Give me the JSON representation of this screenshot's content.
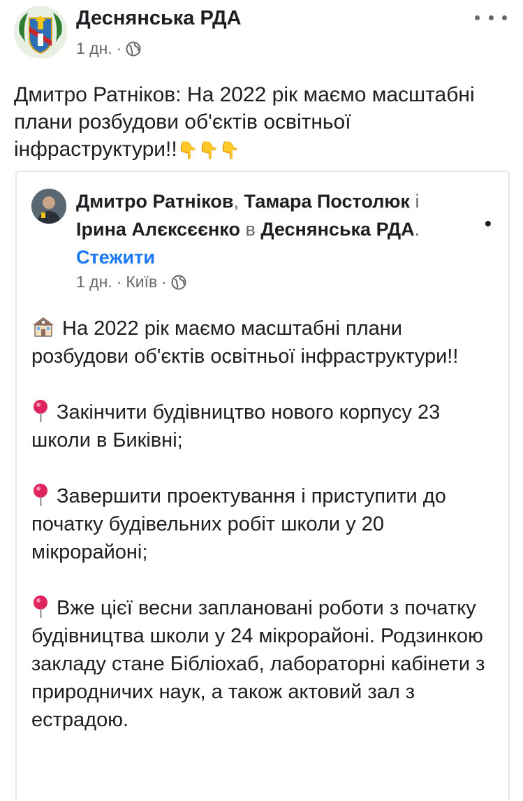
{
  "post": {
    "page_name": "Деснянська РДА",
    "time": "1 дн.",
    "meta_dot": "·",
    "text_main": "Дмитро Ратніков: На 2022 рік маємо масштабні плани розбудови об'єктів освітньої інфраструктури!!",
    "hand_emojis": [
      "👇",
      "👇",
      "👇"
    ],
    "audience_icon": "globe-icon"
  },
  "shared": {
    "author1": "Дмитро Ратніков",
    "comma": ",",
    "author2": "Тамара Постолюк",
    "and_word": "і",
    "author3": "Ірина Алєксєєнко",
    "in_word": "в",
    "page": "Деснянська РДА",
    "period": ".",
    "separator": "•",
    "follow_label": "Стежити",
    "time": "1 дн.",
    "location": "Київ",
    "meta_dot": "·",
    "audience_icon": "globe-icon",
    "paragraphs": [
      {
        "icon": "school-icon",
        "text": "На 2022 рік маємо масштабні плани розбудови об'єктів освітньої інфраструктури!!"
      },
      {
        "icon": "pin-icon",
        "text": "Закінчити будівництво нового корпусу 23 школи в Биківні;"
      },
      {
        "icon": "pin-icon",
        "text": "Завершити проектування і приступити до початку будівельних робіт школи у 20 мікрорайоні;"
      },
      {
        "icon": "pin-icon",
        "text": "Вже цієї весни заплановані роботи з початку будівництва школи у 24 мікрорайоні. Родзинкою закладу стане Бібліохаб, лабораторні кабінети з природничих наук, а також актовий зал з естрадою."
      }
    ]
  },
  "colors": {
    "link_blue": "#1877f2",
    "meta_gray": "#65676b",
    "text": "#1c1e21",
    "pin_red": "#e0245e"
  }
}
